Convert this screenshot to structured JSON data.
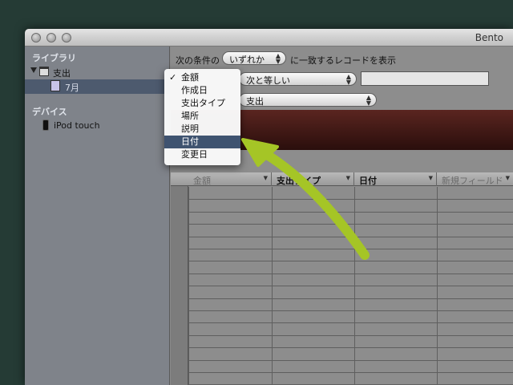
{
  "window": {
    "title": "Bento"
  },
  "sidebar": {
    "library_header": "ライブラリ",
    "library_items": [
      {
        "label": "支出",
        "icon": "calendar-icon"
      },
      {
        "label": "7月",
        "icon": "smart-collection-icon"
      }
    ],
    "devices_header": "デバイス",
    "device_items": [
      {
        "label": "iPod touch",
        "icon": "ipod-icon"
      }
    ]
  },
  "search": {
    "prefix": "次の条件の",
    "match_mode": "いずれか",
    "suffix": "に一致するレコードを表示",
    "operator": "次と等しい",
    "field_value": "支出",
    "value_input": ""
  },
  "field_menu": {
    "items": [
      "金額",
      "作成日",
      "支出タイプ",
      "場所",
      "説明",
      "日付",
      "変更日"
    ],
    "checked_index": 0,
    "highlighted_index": 5
  },
  "table": {
    "columns": [
      "金額",
      "支出タイプ",
      "日付",
      "新規フィールド"
    ],
    "row_count": 16
  },
  "colors": {
    "accent_arrow": "#a5c526",
    "selection": "#3f5370",
    "background": "#253b35"
  }
}
